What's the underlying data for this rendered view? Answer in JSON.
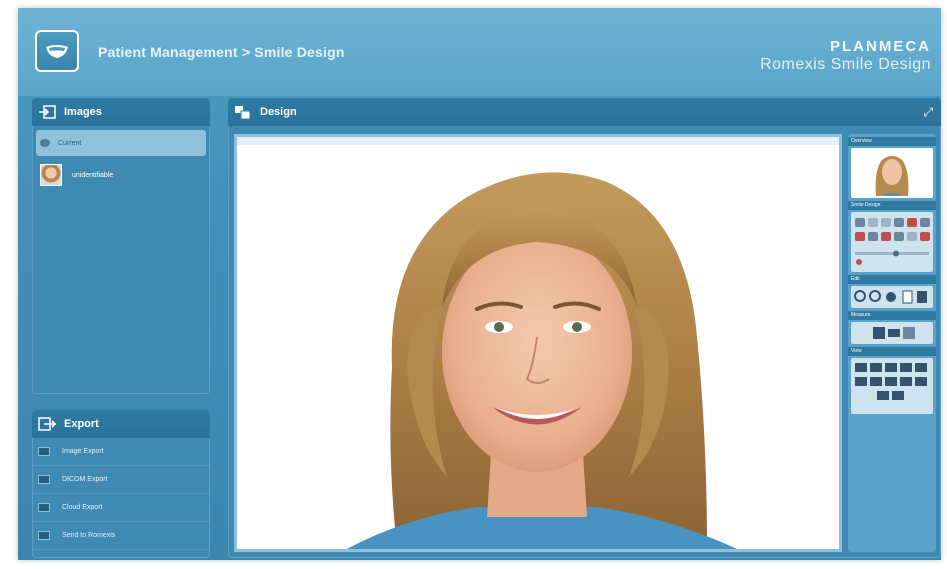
{
  "header": {
    "title": "Patient Management > Smile Design",
    "brand_line1": "PLANMECA",
    "brand_line2": "Romexis Smile Design"
  },
  "images_panel": {
    "title": "Images",
    "items": [
      {
        "label": "Current",
        "selected": true
      },
      {
        "label": "unidentifiable",
        "selected": false
      }
    ]
  },
  "export_panel": {
    "title": "Export",
    "items": [
      {
        "label": "Image Export"
      },
      {
        "label": "DICOM Export"
      },
      {
        "label": "Cloud Export"
      },
      {
        "label": "Send to Romexis"
      }
    ]
  },
  "design_panel": {
    "title": "Design",
    "tool_sections": [
      "Overview",
      "Smile Design",
      "Edit",
      "Measure",
      "View"
    ]
  },
  "colors": {
    "app_bg": "#3f8cb4",
    "header_bg": "#5aa5c9",
    "panel_head": "#2f7aa3",
    "selected": "#8fc1dc"
  }
}
